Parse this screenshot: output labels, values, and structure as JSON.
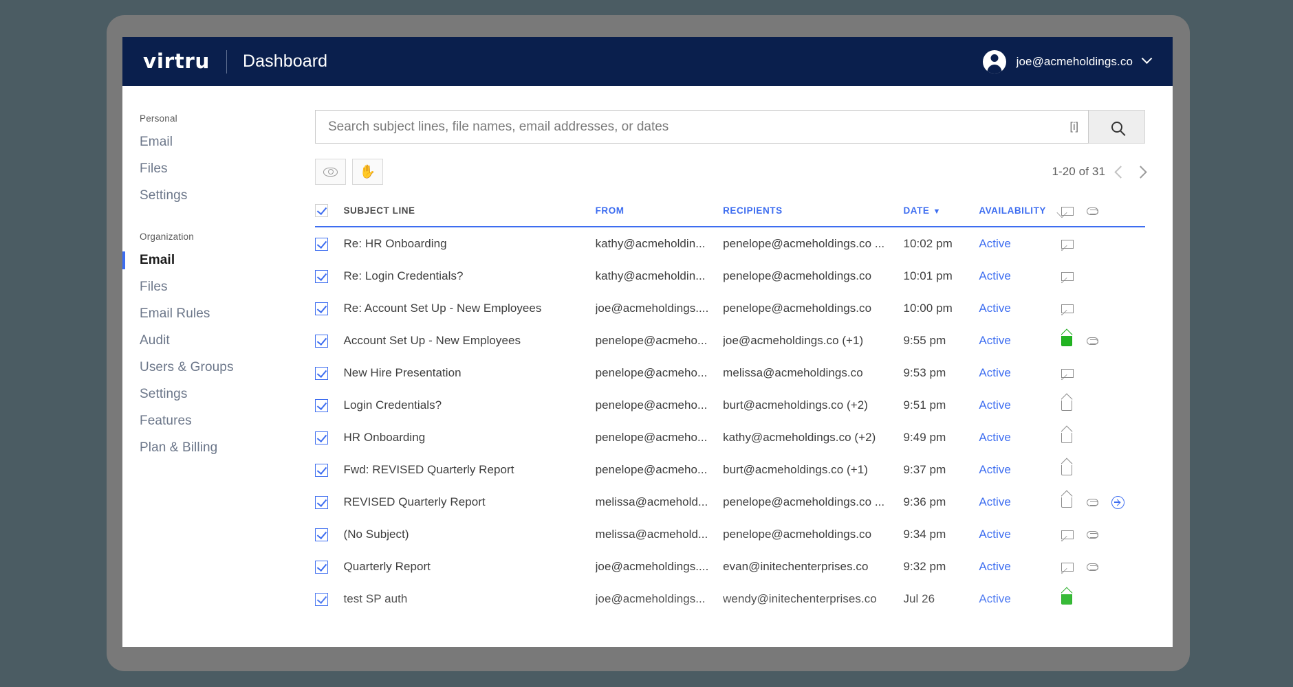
{
  "topbar": {
    "logo": "virtru",
    "title": "Dashboard",
    "account_email": "joe@acmeholdings.co"
  },
  "sidebar": {
    "groups": [
      {
        "label": "Personal",
        "items": [
          {
            "label": "Email",
            "active": false
          },
          {
            "label": "Files",
            "active": false
          },
          {
            "label": "Settings",
            "active": false
          }
        ]
      },
      {
        "label": "Organization",
        "items": [
          {
            "label": "Email",
            "active": true
          },
          {
            "label": "Files",
            "active": false
          },
          {
            "label": "Email Rules",
            "active": false
          },
          {
            "label": "Audit",
            "active": false
          },
          {
            "label": "Users & Groups",
            "active": false
          },
          {
            "label": "Settings",
            "active": false
          },
          {
            "label": "Features",
            "active": false
          },
          {
            "label": "Plan & Billing",
            "active": false
          }
        ]
      }
    ]
  },
  "search": {
    "value": "",
    "placeholder": "Search subject lines, file names, email addresses, or dates",
    "info_label": "[i]",
    "button_icon": "search-icon"
  },
  "toolbar": {
    "view_icon": "eye-icon",
    "revoke_icon": "hand-icon"
  },
  "pagination": {
    "range": "1-20 of 31",
    "prev_icon": "chevron-left-icon",
    "next_icon": "chevron-right-icon"
  },
  "table": {
    "headers": {
      "subject": "SUBJECT LINE",
      "from": "FROM",
      "recipients": "RECIPIENTS",
      "date": "DATE",
      "date_sort": "▼",
      "availability": "AVAILABILITY",
      "icon_read": "envelope-icon",
      "icon_attachment": "paperclip-icon"
    },
    "rows": [
      {
        "checked": true,
        "subject": "Re: HR Onboarding",
        "from": "kathy@acmeholdin...",
        "recipients": "penelope@acmeholdings.co ...",
        "date": "10:02 pm",
        "availability": "Active",
        "read": "closed",
        "attachment": false,
        "forwarded": false
      },
      {
        "checked": true,
        "subject": "Re: Login Credentials?",
        "from": "kathy@acmeholdin...",
        "recipients": "penelope@acmeholdings.co",
        "date": "10:01 pm",
        "availability": "Active",
        "read": "closed",
        "attachment": false,
        "forwarded": false
      },
      {
        "checked": true,
        "subject": "Re: Account Set Up - New Employees",
        "from": "joe@acmeholdings....",
        "recipients": "penelope@acmeholdings.co",
        "date": "10:00 pm",
        "availability": "Active",
        "read": "closed",
        "attachment": false,
        "forwarded": false
      },
      {
        "checked": true,
        "subject": "Account Set Up - New Employees",
        "from": "penelope@acmeho...",
        "recipients": "joe@acmeholdings.co (+1)",
        "date": "9:55 pm",
        "availability": "Active",
        "read": "open-green",
        "attachment": true,
        "forwarded": false
      },
      {
        "checked": true,
        "subject": "New Hire Presentation",
        "from": "penelope@acmeho...",
        "recipients": "melissa@acmeholdings.co",
        "date": "9:53 pm",
        "availability": "Active",
        "read": "closed",
        "attachment": false,
        "forwarded": false
      },
      {
        "checked": true,
        "subject": "Login Credentials?",
        "from": "penelope@acmeho...",
        "recipients": "burt@acmeholdings.co (+2)",
        "date": "9:51 pm",
        "availability": "Active",
        "read": "open-gray",
        "attachment": false,
        "forwarded": false
      },
      {
        "checked": true,
        "subject": "HR Onboarding",
        "from": "penelope@acmeho...",
        "recipients": "kathy@acmeholdings.co (+2)",
        "date": "9:49 pm",
        "availability": "Active",
        "read": "open-gray",
        "attachment": false,
        "forwarded": false
      },
      {
        "checked": true,
        "subject": "Fwd: REVISED Quarterly Report",
        "from": "penelope@acmeho...",
        "recipients": "burt@acmeholdings.co (+1)",
        "date": "9:37 pm",
        "availability": "Active",
        "read": "open-gray",
        "attachment": false,
        "forwarded": false
      },
      {
        "checked": true,
        "subject": "REVISED Quarterly Report",
        "from": "melissa@acmehold...",
        "recipients": "penelope@acmeholdings.co ...",
        "date": "9:36 pm",
        "availability": "Active",
        "read": "open-gray",
        "attachment": true,
        "forwarded": true
      },
      {
        "checked": true,
        "subject": "(No Subject)",
        "from": "melissa@acmehold...",
        "recipients": "penelope@acmeholdings.co",
        "date": "9:34 pm",
        "availability": "Active",
        "read": "closed",
        "attachment": true,
        "forwarded": false
      },
      {
        "checked": true,
        "subject": "Quarterly Report",
        "from": "joe@acmeholdings....",
        "recipients": "evan@initechenterprises.co",
        "date": "9:32 pm",
        "availability": "Active",
        "read": "closed",
        "attachment": true,
        "forwarded": false
      },
      {
        "checked": true,
        "subject": "test SP auth",
        "from": "joe@acmeholdings...",
        "recipients": "wendy@initechenterprises.co",
        "date": "Jul 26",
        "availability": "Active",
        "read": "open-green",
        "attachment": false,
        "forwarded": false
      }
    ]
  }
}
